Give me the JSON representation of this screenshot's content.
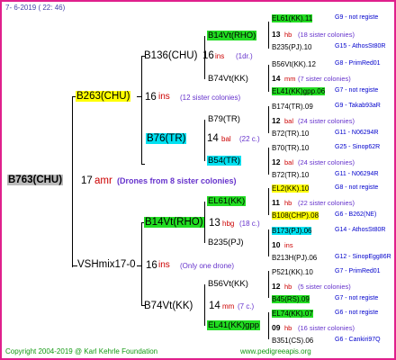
{
  "header": {
    "date": "7-  6-2019 ( 22: 46)"
  },
  "root": {
    "code": "B763(CHU)",
    "count": "17",
    "sign": "amr",
    "note": "(Drones from 8 sister colonies)"
  },
  "queen": {
    "code": "B263(CHU)",
    "count": "16",
    "sign": "ins",
    "note": "(12 sister colonies)",
    "gm": {
      "code": "B136(CHU)",
      "count": "16",
      "sign": "ins",
      "note": "(1dr.)"
    },
    "gf": {
      "code": "B76(TR)",
      "count": "14",
      "sign": "bal",
      "note": "(22 c.)"
    },
    "ggm1": {
      "code": "B14Vt(RHO)"
    },
    "ggf1": {
      "code": "B74Vt(KK)"
    },
    "ggm2": {
      "code": "B79(TR)"
    },
    "ggf2": {
      "code": "B54(TR)"
    }
  },
  "drone": {
    "code": "VSHmix17-0",
    "count": "16",
    "sign": "ins",
    "note": "(Only one drone)",
    "gm": {
      "code": "B14Vt(RHO)",
      "count": "13",
      "sign": "hbg",
      "note": "(18 c.)"
    },
    "gf": {
      "code": "B74Vt(KK)",
      "count": "14",
      "sign": "mm",
      "note": "(7 c.)"
    },
    "ggm1": {
      "code": "EL61(KK)"
    },
    "ggf1": {
      "code": "B235(PJ)"
    },
    "ggm2": {
      "code": "B56Vt(KK)"
    },
    "ggf2": {
      "code": "EL41(KK)gpp"
    }
  },
  "right": [
    {
      "code": "EL61(KK).11",
      "tag": "G9 - not registe"
    },
    {
      "count": "13",
      "sign": "hb",
      "note": "(18 sister colonies)"
    },
    {
      "code": "B235(PJ).10",
      "tag": "G15 - AthosSt80R"
    },
    {
      "code": "B56Vt(KK).12",
      "tag": "G8 - PrimRed01"
    },
    {
      "count": "14",
      "sign": "mm",
      "note": "(7 sister colonies)"
    },
    {
      "code": "EL41(KK)gpp.06",
      "tag": "G7 - not registe"
    },
    {
      "code": "B174(TR).09",
      "tag": "G9 - Takab93aR"
    },
    {
      "count": "12",
      "sign": "bal",
      "note": "(24 sister colonies)"
    },
    {
      "code": "B72(TR).10",
      "tag": "G11 - N06294R"
    },
    {
      "code": "B70(TR).10",
      "tag": "G25 - Sinop62R"
    },
    {
      "count": "12",
      "sign": "bal",
      "note": "(24 sister colonies)"
    },
    {
      "code": "B72(TR).10",
      "tag": "G11 - N06294R"
    },
    {
      "code": "EL2(KK).10",
      "tag": "G8 - not registe"
    },
    {
      "count": "11",
      "sign": "hb",
      "note": "(22 sister colonies)"
    },
    {
      "code": "B108(CHP).08",
      "tag": "G6 - B262(NE)"
    },
    {
      "code": "B173(PJ).06",
      "tag": "G14 - AthosSt80R"
    },
    {
      "count": "10",
      "sign": "ins",
      "note": ""
    },
    {
      "code": "B213H(PJ).06",
      "tag": "G12 - SinopEgg86R"
    },
    {
      "code": "P521(KK).10",
      "tag": "G7 - PrimRed01"
    },
    {
      "count": "12",
      "sign": "hb",
      "note": "(5 sister colonies)"
    },
    {
      "code": "B45(RS).09",
      "tag": "G7 - not registe"
    },
    {
      "code": "EL74(KK).07",
      "tag": "G6 - not registe"
    },
    {
      "count": "09",
      "sign": "hb",
      "note": "(16 sister colonies)"
    },
    {
      "code": "B351(CS).06",
      "tag": "G6 - Cankiri97Q"
    }
  ],
  "footer": {
    "copyright": "Copyright 2004-2019 @ Karl Kehrle Foundation",
    "url": "www.pedigreeapis.org"
  },
  "colors": {
    "border": "#e0208c",
    "green": "#22dd22",
    "yellow": "#ffff00",
    "cyan": "#00e0f0",
    "red": "#cc0000",
    "purple": "#6633cc",
    "blue": "#0000cc"
  }
}
